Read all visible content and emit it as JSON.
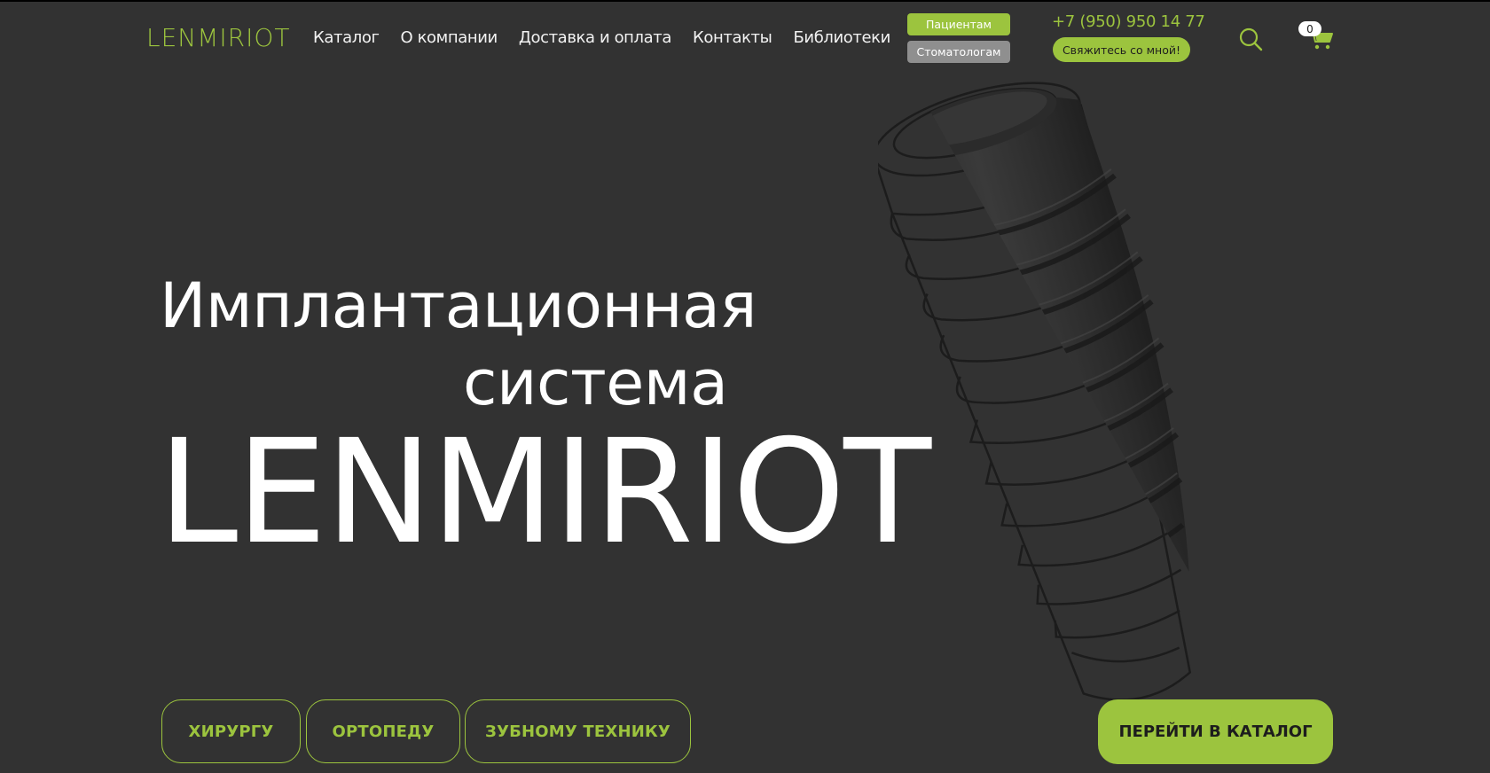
{
  "header": {
    "logo": "LENMIRIOT",
    "nav": [
      {
        "label": "Каталог"
      },
      {
        "label": "О компании"
      },
      {
        "label": "Доставка и оплата"
      },
      {
        "label": "Контакты"
      },
      {
        "label": "Библиотеки"
      }
    ],
    "audience_buttons": {
      "patients": "Пациентам",
      "dentists": "Стоматологам"
    },
    "phone": "+7 (950) 950 14 77",
    "callback_label": "Свяжитесь со мной!",
    "cart_count": "0"
  },
  "hero": {
    "line1": "Имплантационная",
    "line2": "система",
    "brand": "LENMIRIOT"
  },
  "buttons": {
    "surgeon": "ХИРУРГУ",
    "orthopedist": "ОРТОПЕДУ",
    "technician": "ЗУБНОМУ ТЕХНИКУ",
    "catalog": "ПЕРЕЙТИ В КАТАЛОГ"
  },
  "colors": {
    "background": "#323232",
    "accent": "#9cc43e",
    "secondary": "#8f8f8f",
    "text": "#ffffff"
  },
  "icons": [
    "search-icon",
    "cart-icon",
    "implant-illustration"
  ]
}
